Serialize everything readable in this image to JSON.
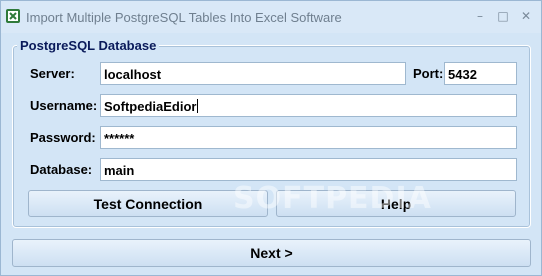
{
  "window": {
    "title": "Import Multiple PostgreSQL Tables Into Excel Software",
    "minimize_glyph": "–",
    "maximize_glyph": "□",
    "close_glyph": "✕"
  },
  "group": {
    "legend": "PostgreSQL Database"
  },
  "form": {
    "server_label": "Server:",
    "server_value": "localhost",
    "port_label": "Port:",
    "port_value": "5432",
    "username_label": "Username:",
    "username_value": "SoftpediaEdior",
    "password_label": "Password:",
    "password_value": "******",
    "database_label": "Database:",
    "database_value": "main"
  },
  "buttons": {
    "test_connection": "Test Connection",
    "help": "Help",
    "next": "Next >"
  },
  "watermark": "SOFTPEDIA",
  "colors": {
    "window_bg": "#d3e5f6",
    "legend_text": "#0a1a5a",
    "title_text": "#6f7f8f"
  }
}
